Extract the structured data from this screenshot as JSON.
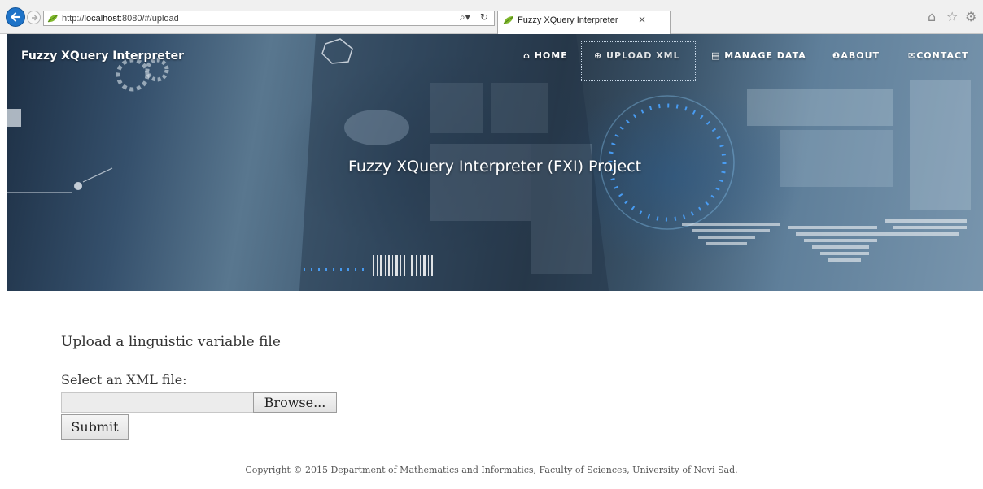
{
  "browser": {
    "url_prefix": "http://",
    "url_host": "localhost",
    "url_rest": ":8080/#/upload",
    "tab_title": "Fuzzy XQuery Interpreter",
    "tab_close": "×"
  },
  "site": {
    "brand": "Fuzzy XQuery Interpreter",
    "nav": [
      {
        "label": "HOME",
        "icon": "home-icon"
      },
      {
        "label": "UPLOAD XML",
        "icon": "upload-icon"
      },
      {
        "label": "MANAGE DATA",
        "icon": "list-icon"
      },
      {
        "label": "ABOUT",
        "icon": "info-icon"
      },
      {
        "label": "CONTACT",
        "icon": "mail-icon"
      }
    ],
    "active_nav": "UPLOAD XML",
    "hero_title": "Fuzzy XQuery Interpreter (FXI) Project"
  },
  "upload": {
    "heading": "Upload a linguistic variable file",
    "file_label": "Select an XML file:",
    "file_value": "",
    "browse_label": "Browse...",
    "submit_label": "Submit"
  },
  "footer": {
    "copyright": "Copyright © 2015 Department of Mathematics and Informatics, Faculty of Sciences, University of Novi Sad."
  },
  "colors": {
    "browser_accent": "#1e73c8",
    "hero_dark": "#2b3b4b",
    "hero_light": "#7895ad",
    "glow": "#4aa3ff"
  }
}
